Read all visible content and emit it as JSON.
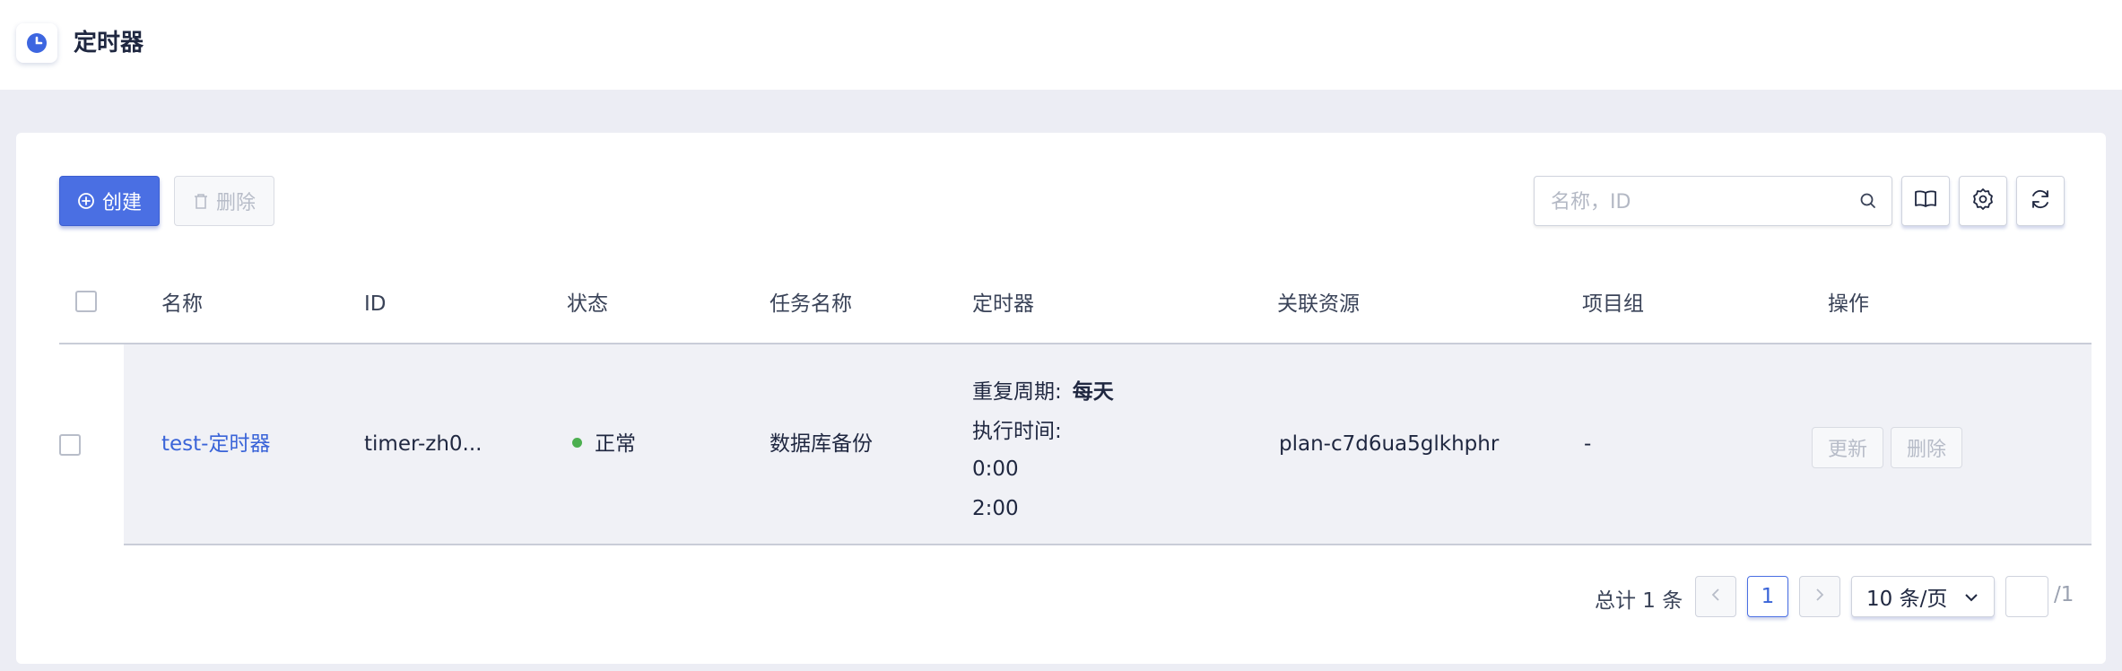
{
  "header": {
    "title": "定时器",
    "icon": "clock-icon"
  },
  "toolbar": {
    "create_label": "创建",
    "delete_label": "删除",
    "search_placeholder": "名称，ID",
    "icons": [
      "book-icon",
      "gear-icon",
      "refresh-icon"
    ]
  },
  "table": {
    "columns": [
      "名称",
      "ID",
      "状态",
      "任务名称",
      "定时器",
      "关联资源",
      "项目组",
      "操作"
    ],
    "rows": [
      {
        "name": "test-定时器",
        "id": "timer-zh0...",
        "status": "正常",
        "task_name": "数据库备份",
        "schedule": {
          "repeat_label": "重复周期:",
          "repeat_value": "每天",
          "exec_label": "执行时间:",
          "times": [
            "0:00",
            "2:00"
          ]
        },
        "resource": "plan-c7d6ua5glkhphr",
        "project_group": "-",
        "actions": {
          "update": "更新",
          "delete": "删除"
        }
      }
    ]
  },
  "pagination": {
    "total_text": "总计 1 条",
    "current_page": "1",
    "page_size": "10 条/页",
    "jump_value": "",
    "total_pages": "/1"
  },
  "colors": {
    "primary": "#4a6fe3",
    "link": "#3a64d8",
    "status_ok": "#4caf50",
    "background": "#ecedf4"
  }
}
